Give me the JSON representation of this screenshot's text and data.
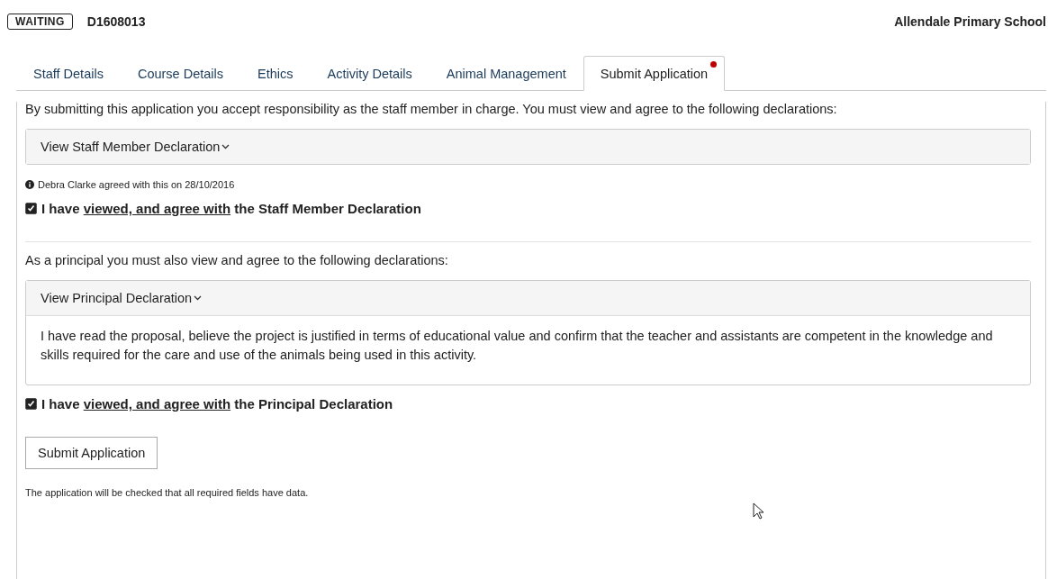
{
  "status_badge": "WAITING",
  "reference": "D1608013",
  "school": "Allendale Primary School",
  "tabs": [
    {
      "label": "Staff Details",
      "selected": false,
      "alert": false
    },
    {
      "label": "Course Details",
      "selected": false,
      "alert": false
    },
    {
      "label": "Ethics",
      "selected": false,
      "alert": false
    },
    {
      "label": "Activity Details",
      "selected": false,
      "alert": false
    },
    {
      "label": "Animal Management",
      "selected": false,
      "alert": false
    },
    {
      "label": "Submit Application",
      "selected": true,
      "alert": true
    }
  ],
  "sections": [
    {
      "lead": "By submitting this application you accept responsibility as the staff member in charge. You must view and agree to the following declarations:",
      "accordion": {
        "label": "View Staff Member Declaration",
        "expanded": false
      },
      "info": "Debra Clarke agreed with this on 28/10/2016",
      "agreement": {
        "checked": true,
        "prefix": "I have",
        "link": "viewed, and agree with",
        "suffix": "the Staff Member Declaration"
      }
    },
    {
      "lead": "As a principal you must also view and agree to the following declarations:",
      "accordion": {
        "label": "View Principal Declaration",
        "expanded": true,
        "body": "I have read the proposal, believe the project is justified in terms of educational value and confirm that the teacher and assistants are competent in the knowledge and skills required for the care and use of the animals being used in this activity."
      },
      "agreement": {
        "checked": true,
        "prefix": "I have",
        "link": "viewed, and agree with",
        "suffix": "the Principal Declaration"
      }
    }
  ],
  "submit_button": "Submit Application",
  "note": "The application will be checked that all required fields have data."
}
